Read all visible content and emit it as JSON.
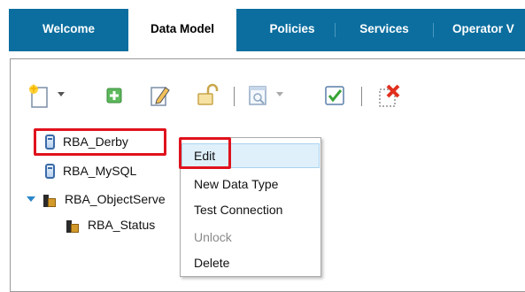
{
  "tabs": [
    {
      "label": "Welcome",
      "active": false
    },
    {
      "label": "Data Model",
      "active": true
    },
    {
      "label": "Policies",
      "active": false
    },
    {
      "label": "Services",
      "active": false
    },
    {
      "label": "Operator V",
      "active": false
    }
  ],
  "toolbar": {
    "icons": [
      "new-icon",
      "add-icon",
      "edit-icon",
      "unlock-icon",
      "view-icon",
      "check-icon",
      "delete-icon"
    ]
  },
  "tree": {
    "items": [
      {
        "label": "RBA_Derby",
        "icon": "datasource-icon"
      },
      {
        "label": "RBA_MySQL",
        "icon": "datasource-icon"
      },
      {
        "label": "RBA_ObjectServe",
        "icon": "objectserver-icon",
        "expanded": true
      },
      {
        "label": "RBA_Status",
        "icon": "objectserver-icon"
      }
    ]
  },
  "context_menu": {
    "items": [
      {
        "label": "Edit",
        "state": "hover"
      },
      {
        "label": "New Data Type",
        "state": "normal"
      },
      {
        "label": "Test Connection",
        "state": "normal"
      },
      {
        "label": "Unlock",
        "state": "disabled"
      },
      {
        "label": "Delete",
        "state": "normal"
      }
    ]
  },
  "colors": {
    "tabbar": "#0b6e9f",
    "highlight": "#e0121d",
    "menu_hover": "#dff0fb"
  }
}
